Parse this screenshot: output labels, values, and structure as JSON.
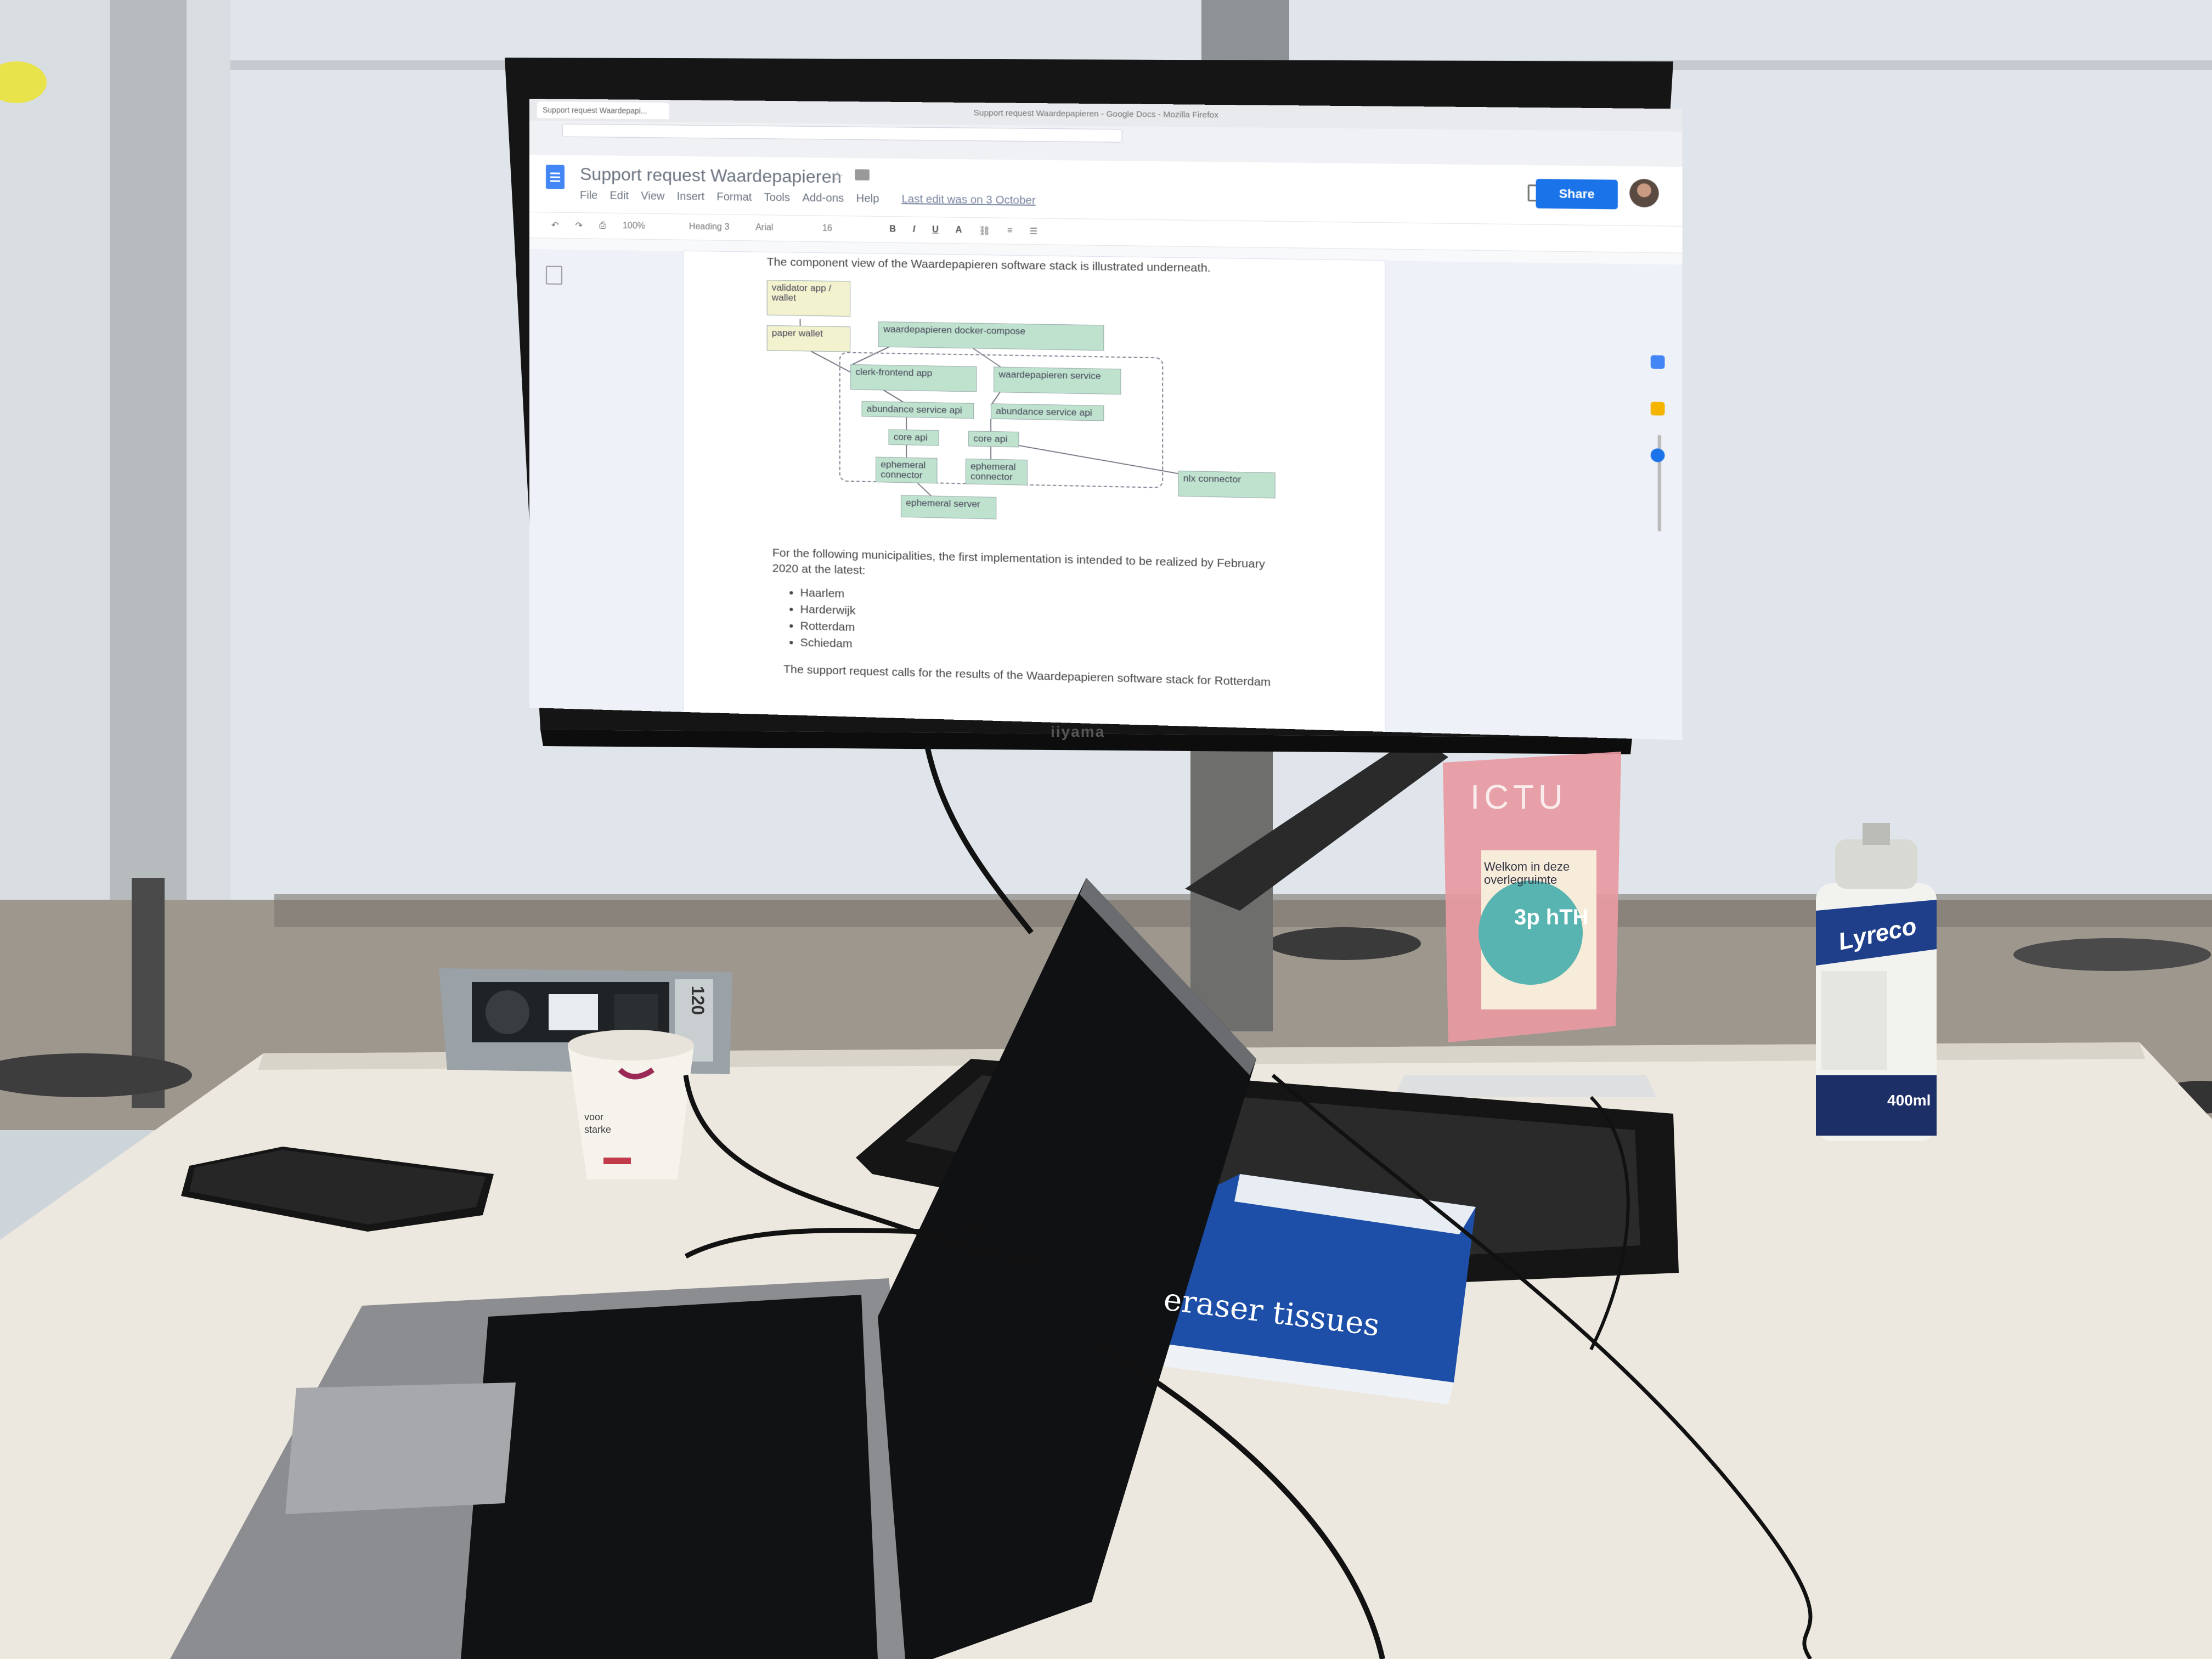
{
  "browser": {
    "window_title": "Support request Waardepapieren - Google Docs - Mozilla Firefox",
    "tab_label": "Support request Waardepapi..."
  },
  "doc": {
    "title": "Support request Waardepapieren",
    "menu": [
      "File",
      "Edit",
      "View",
      "Insert",
      "Format",
      "Tools",
      "Add-ons",
      "Help"
    ],
    "last_edit": "Last edit was on 3 October",
    "share_label": "Share",
    "toolbar": {
      "zoom": "100%",
      "style": "Heading 3",
      "font": "Arial",
      "size": "16"
    },
    "intro": "The component view of the Waardepapieren software stack is illustrated underneath.",
    "diagram_nodes": [
      "validator app / wallet",
      "paper wallet",
      "waardepapieren docker-compose",
      "clerk-frontend app",
      "waardepapieren service",
      "abundance service api",
      "abundance service api",
      "core api",
      "core api",
      "ephemeral connector",
      "ephemeral connector",
      "nlx connector",
      "ephemeral server"
    ],
    "paragraph": "For the following municipalities, the first implementation is intended to be realized by February 2020 at the latest:",
    "municipalities": [
      "Haarlem",
      "Harderwijk",
      "Rotterdam",
      "Schiedam"
    ],
    "next_line": "The support request calls for the results of the Waardepapieren software stack for Rotterdam"
  },
  "room": {
    "monitor_brand": "iiyama",
    "spray_brand": "Lyreco",
    "spray_volume": "400ml",
    "tissue_label": "eraser tissues",
    "sign_title": "ICTU",
    "sign_welcome": "Welkom in deze\noverlegruimte",
    "sign_logo": "3p hTH",
    "socket_number": "120",
    "cup_text": "voor starke"
  },
  "colors": {
    "share_button": "#1a73e8",
    "diagram_green": "#bfe2cf",
    "diagram_yellow": "#f3f2cf",
    "sign_pink": "#e89aa2",
    "spray_can": "#f2f2ee",
    "desk": "#eeeae2"
  }
}
